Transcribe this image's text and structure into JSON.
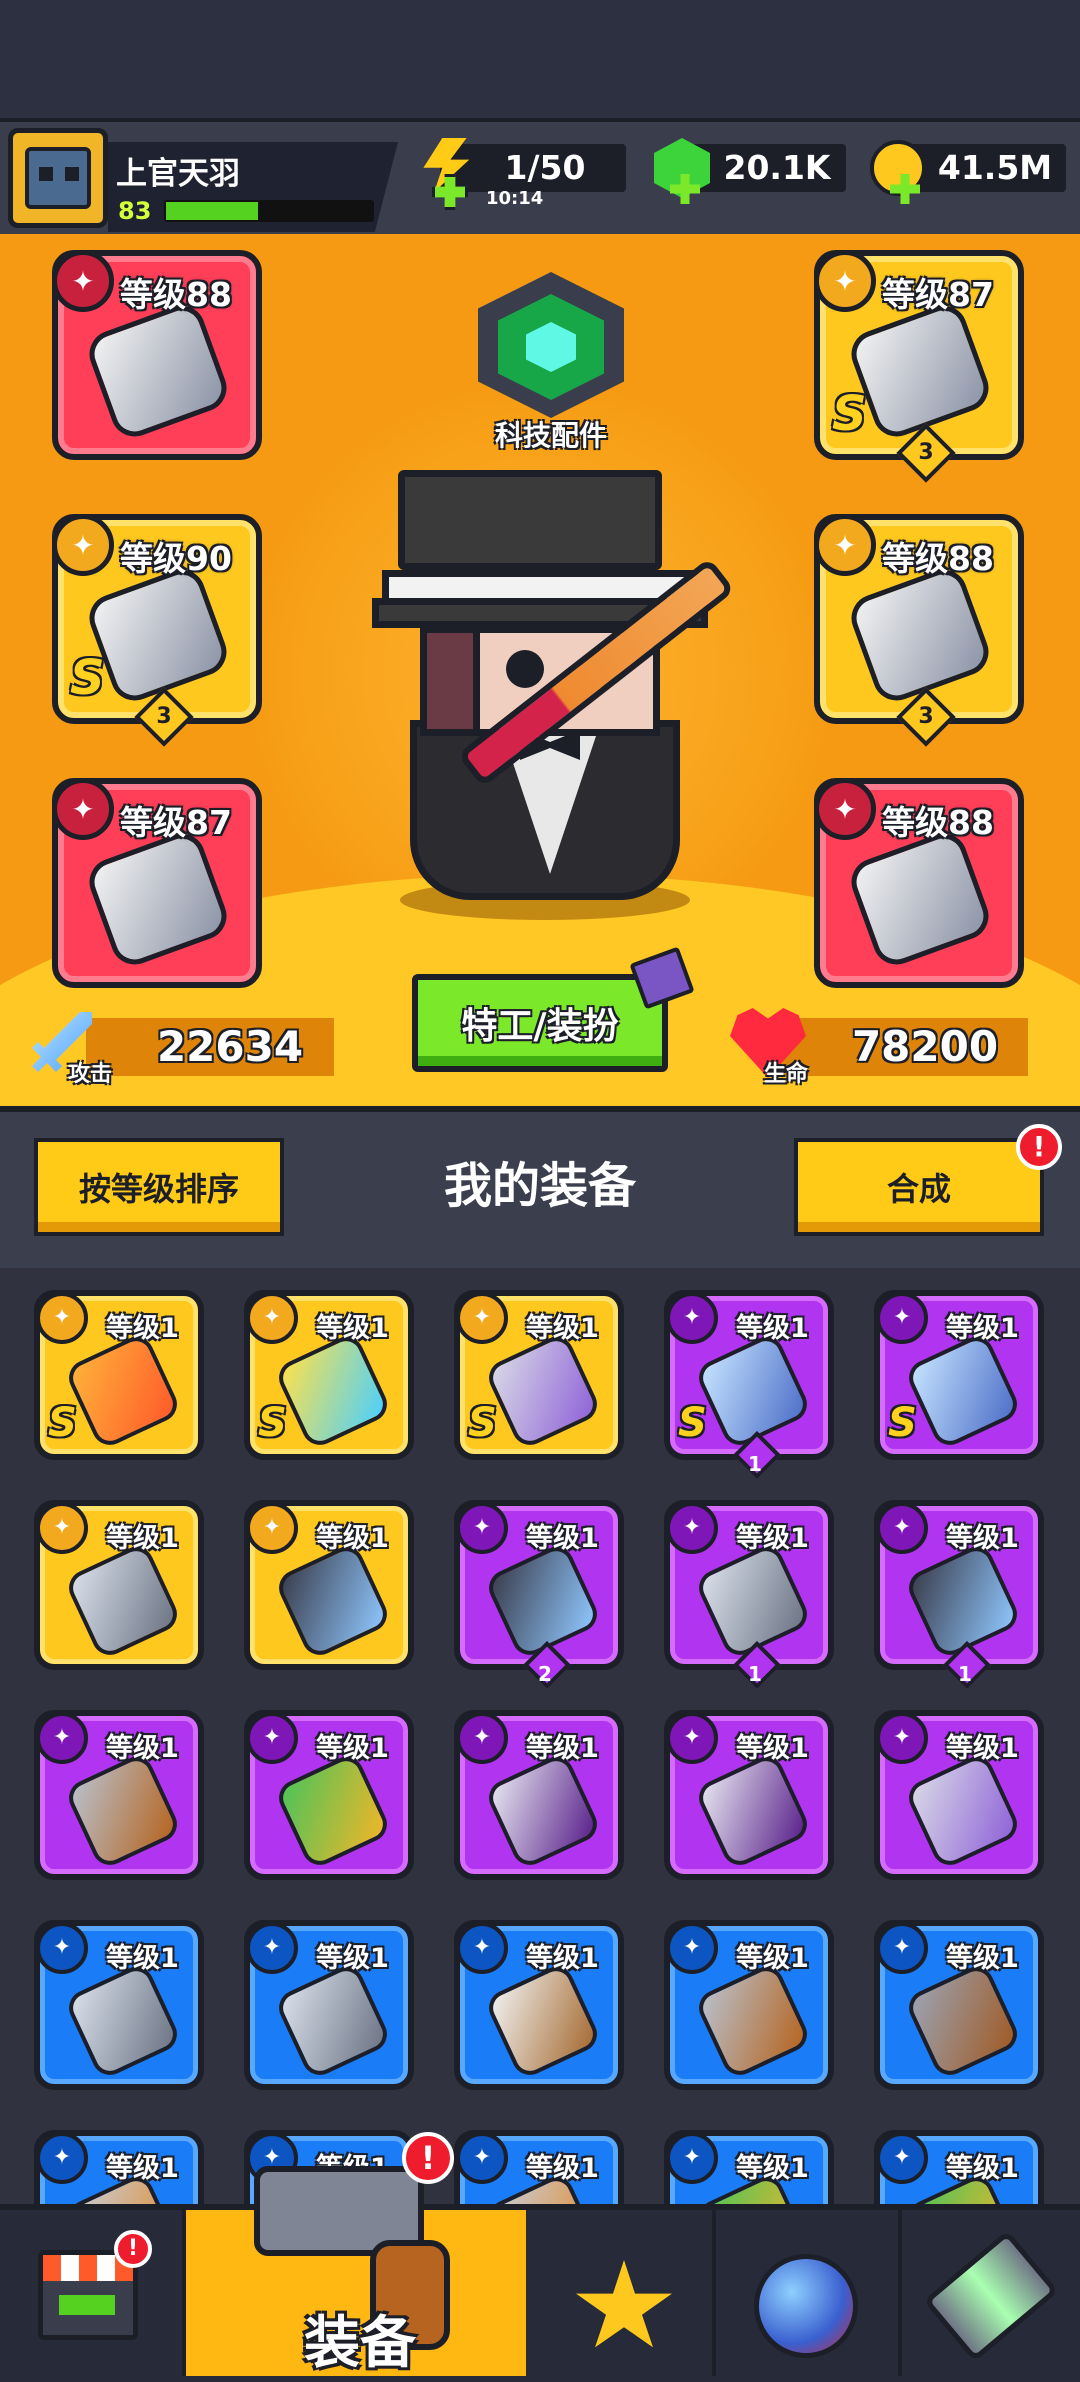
{
  "player": {
    "name": "上官天羽",
    "level": "83"
  },
  "resources": {
    "energy": {
      "value": "1/50",
      "timer": "10:14"
    },
    "gems": {
      "value": "20.1K"
    },
    "coins": {
      "value": "41.5M"
    }
  },
  "equipped": {
    "left": [
      {
        "level": "等级88",
        "grade": "",
        "stars": "",
        "type": "weapon",
        "color": "#ff3f58"
      },
      {
        "level": "等级90",
        "grade": "S",
        "stars": "3",
        "type": "necklace",
        "color": "#ffc81f"
      },
      {
        "level": "等级87",
        "grade": "",
        "stars": "",
        "type": "gloves",
        "color": "#ff3f58"
      }
    ],
    "right": [
      {
        "level": "等级87",
        "grade": "S",
        "stars": "3",
        "type": "armor",
        "color": "#ffc81f"
      },
      {
        "level": "等级88",
        "grade": "",
        "stars": "3",
        "type": "belt",
        "color": "#ffc81f"
      },
      {
        "level": "等级88",
        "grade": "",
        "stars": "",
        "type": "boots",
        "color": "#ff3f58"
      }
    ]
  },
  "tech_label": "科技配件",
  "stats": {
    "attack": {
      "label": "攻击",
      "value": "22634"
    },
    "hp": {
      "label": "生命",
      "value": "78200"
    }
  },
  "agent_button": "特工/装扮",
  "inventory_header": {
    "sort_label": "按等级排序",
    "title": "我的装备",
    "merge_label": "合成",
    "merge_badge": "!"
  },
  "inventory": [
    {
      "level": "等级1",
      "grade": "S",
      "stars": "",
      "rarity": "gold",
      "type": "sword"
    },
    {
      "level": "等级1",
      "grade": "S",
      "stars": "",
      "rarity": "gold",
      "type": "necklace"
    },
    {
      "level": "等级1",
      "grade": "S",
      "stars": "",
      "rarity": "gold",
      "type": "boots"
    },
    {
      "level": "等级1",
      "grade": "S",
      "stars": "1",
      "rarity": "purple",
      "type": "gloves"
    },
    {
      "level": "等级1",
      "grade": "S",
      "stars": "",
      "rarity": "purple",
      "type": "gloves"
    },
    {
      "level": "等级1",
      "grade": "",
      "stars": "",
      "rarity": "gold",
      "type": "kunai"
    },
    {
      "level": "等级1",
      "grade": "",
      "stars": "",
      "rarity": "gold",
      "type": "belt"
    },
    {
      "level": "等级1",
      "grade": "",
      "stars": "2",
      "rarity": "purple",
      "type": "belt"
    },
    {
      "level": "等级1",
      "grade": "",
      "stars": "1",
      "rarity": "purple",
      "type": "kunai"
    },
    {
      "level": "等级1",
      "grade": "",
      "stars": "1",
      "rarity": "purple",
      "type": "belt"
    },
    {
      "level": "等级1",
      "grade": "",
      "stars": "",
      "rarity": "purple",
      "type": "revolver"
    },
    {
      "level": "等级1",
      "grade": "",
      "stars": "",
      "rarity": "purple",
      "type": "armor"
    },
    {
      "level": "等级1",
      "grade": "",
      "stars": "",
      "rarity": "purple",
      "type": "collar"
    },
    {
      "level": "等级1",
      "grade": "",
      "stars": "",
      "rarity": "purple",
      "type": "collar"
    },
    {
      "level": "等级1",
      "grade": "",
      "stars": "",
      "rarity": "purple",
      "type": "boots"
    },
    {
      "level": "等级1",
      "grade": "",
      "stars": "",
      "rarity": "blue",
      "type": "kunai"
    },
    {
      "level": "等级1",
      "grade": "",
      "stars": "",
      "rarity": "blue",
      "type": "kunai"
    },
    {
      "level": "等级1",
      "grade": "",
      "stars": "",
      "rarity": "blue",
      "type": "machete"
    },
    {
      "level": "等级1",
      "grade": "",
      "stars": "",
      "rarity": "blue",
      "type": "revolver"
    },
    {
      "level": "等级1",
      "grade": "",
      "stars": "",
      "rarity": "blue",
      "type": "shotgun"
    },
    {
      "level": "等级1",
      "grade": "",
      "stars": "",
      "rarity": "blue",
      "type": "weapon"
    },
    {
      "level": "等级1",
      "grade": "",
      "stars": "",
      "rarity": "blue",
      "type": "weapon"
    },
    {
      "level": "等级1",
      "grade": "",
      "stars": "",
      "rarity": "blue",
      "type": "weapon"
    },
    {
      "level": "等级1",
      "grade": "",
      "stars": "",
      "rarity": "blue",
      "type": "armor"
    },
    {
      "level": "等级1",
      "grade": "",
      "stars": "",
      "rarity": "blue",
      "type": "armor"
    }
  ],
  "nav": {
    "active_label": "装备",
    "shop_badge": "!",
    "equip_badge": "!"
  }
}
